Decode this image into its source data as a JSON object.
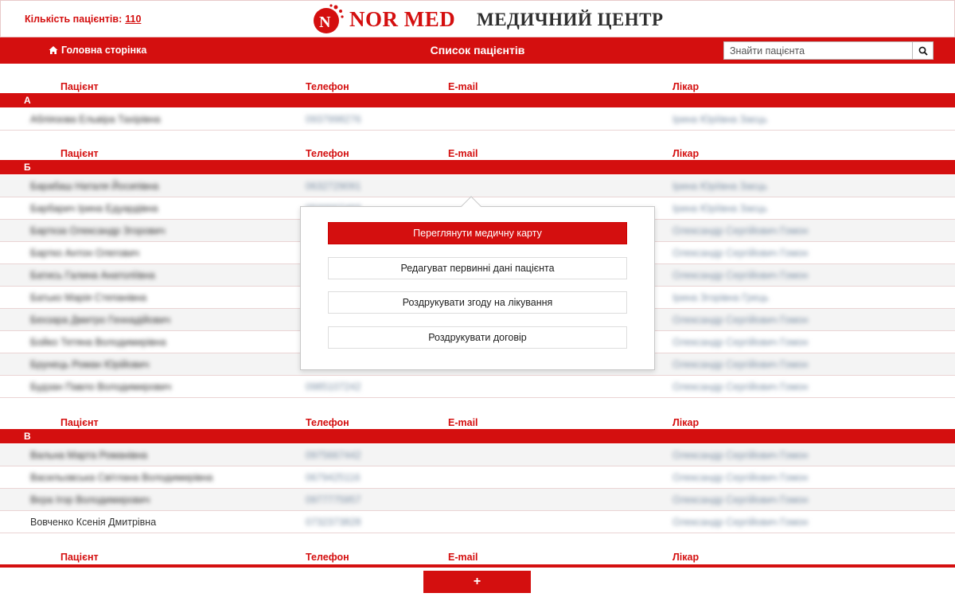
{
  "header": {
    "patient_count_label": "Кількість пацієнтів:",
    "patient_count_value": "110",
    "logo_text": "NOR MED",
    "center_title": "МЕДИЧНИЙ ЦЕНТР"
  },
  "nav": {
    "home_label": "Головна сторінка",
    "list_title": "Список пацієнтів",
    "search_placeholder": "Знайти пацієнта"
  },
  "columns": {
    "patient": "Пацієнт",
    "phone": "Телефон",
    "email": "E-mail",
    "doctor": "Лікар"
  },
  "groups": [
    {
      "letter": "А",
      "rows": [
        {
          "name": "Абліязова Ельвіра Тахірівна",
          "phone": "0937998276",
          "doctor": "Ірина Юріївна Заєць"
        }
      ]
    },
    {
      "letter": "Б",
      "rows": [
        {
          "name": "Барабаш Наталя Йосипівна",
          "phone": "0632729091",
          "doctor": "Ірина Юріївна Заєць"
        },
        {
          "name": "Барбарич Ірина Едуардівна",
          "phone": "0500007493",
          "doctor": "Ірина Юріївна Заєць"
        },
        {
          "name": "Барткза Олександр Згорович",
          "phone": "",
          "doctor": "Олександр Сергійович Гомон"
        },
        {
          "name": "Бартко Антон Олегович",
          "phone": "",
          "doctor": "Олександр Сергійович Гомон"
        },
        {
          "name": "Батись Галина Анатоліївна",
          "phone": "",
          "doctor": "Олександр Сергійович Гомон"
        },
        {
          "name": "Батько Марія Степанівна",
          "phone": "",
          "doctor": "Ірина Згорівна Грець"
        },
        {
          "name": "Бехзара Дмитро Геннадійович",
          "phone": "",
          "doctor": "Олександр Сергійович Гомон"
        },
        {
          "name": "Бойко Тетяна Володимирівна",
          "phone": "",
          "doctor": "Олександр Сергійович Гомон"
        },
        {
          "name": "Брунець Роман Юрійович",
          "phone": "",
          "doctor": "Олександр Сергійович Гомон"
        },
        {
          "name": "Будзан Павло Володимирович",
          "phone": "0985107242",
          "doctor": "Олександр Сергійович Гомон"
        }
      ]
    },
    {
      "letter": "В",
      "rows": [
        {
          "name": "Вальна Марта Романівна",
          "phone": "0975667442",
          "doctor": "Олександр Сергійович Гомон"
        },
        {
          "name": "Васильовська Світлана Володимирівна",
          "phone": "0679425116",
          "doctor": "Олександр Сергійович Гомон"
        },
        {
          "name": "Вєра Ігор Володимирович",
          "phone": "0977775957",
          "doctor": "Олександр Сергійович Гомон"
        },
        {
          "name": "Вовченко Ксенія Дмитрівна",
          "phone": "0732373828",
          "doctor": "Олександр Сергійович Гомон"
        }
      ]
    }
  ],
  "popup": {
    "btn_view_card": "Переглянути медичну карту",
    "btn_edit": "Редагуват первинні дані пацієнта",
    "btn_print_consent": "Роздрукувати згоду на лікування",
    "btn_print_contract": "Роздрукувати договір"
  },
  "footer": {
    "add_label": "+"
  },
  "colors": {
    "accent": "#d40f0f",
    "text_dark": "#333333"
  }
}
